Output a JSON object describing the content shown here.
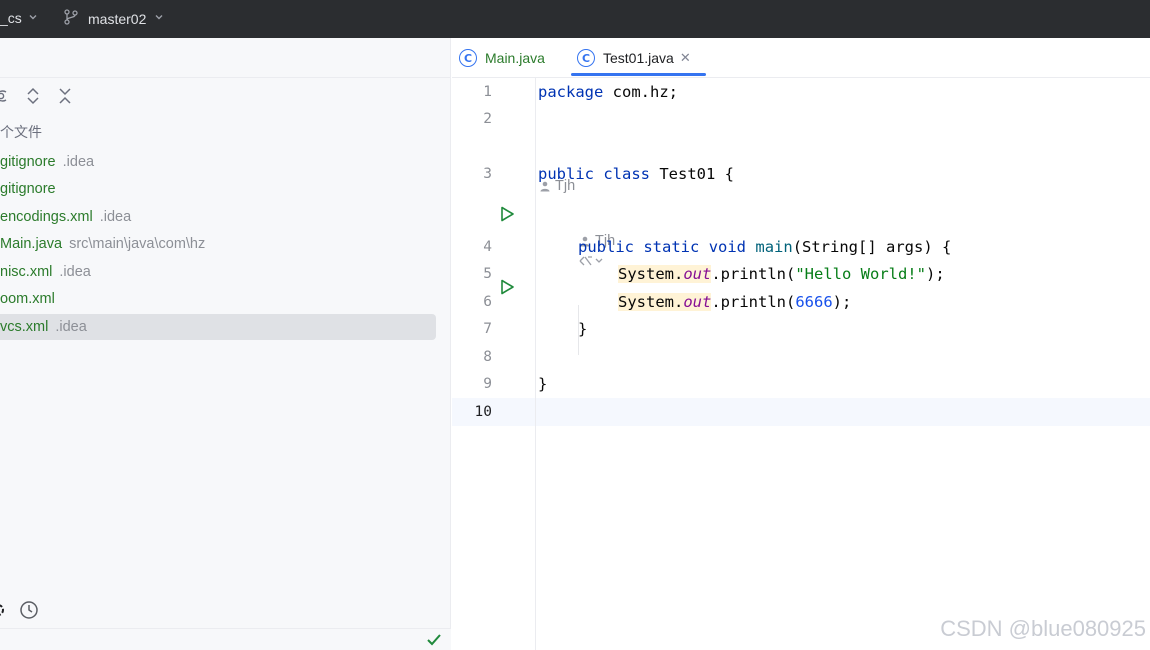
{
  "titlebar": {
    "project": "_cs",
    "branch": "master02"
  },
  "project_panel": {
    "caption": "个文件",
    "files": [
      {
        "name": "gitignore",
        "location": ".idea",
        "selected": false
      },
      {
        "name": "gitignore",
        "location": "",
        "selected": false
      },
      {
        "name": "encodings.xml",
        "location": ".idea",
        "selected": false
      },
      {
        "name": "Main.java",
        "location": "src\\main\\java\\com\\hz",
        "selected": false
      },
      {
        "name": "nisc.xml",
        "location": ".idea",
        "selected": false
      },
      {
        "name": "oom.xml",
        "location": "",
        "selected": false
      },
      {
        "name": "vcs.xml",
        "location": ".idea",
        "selected": true
      }
    ],
    "toolbar_icons": [
      "eye-icon",
      "expand-all-icon",
      "collapse-all-icon"
    ],
    "bottom_icons": [
      "settings-icon",
      "history-icon"
    ],
    "status_icon": "checkmark-icon"
  },
  "editor": {
    "tabs": [
      {
        "label": "Main.java",
        "icon_letter": "C",
        "active": false
      },
      {
        "label": "Test01.java",
        "icon_letter": "C",
        "active": true,
        "close": "✕"
      }
    ],
    "line_numbers": [
      "1",
      "2",
      "3",
      "4",
      "5",
      "6",
      "7",
      "8",
      "9",
      "10"
    ],
    "current_line": "10",
    "author_hint": "Tjh",
    "code": {
      "l1_kw": "package",
      "l1_rest": " com.hz;",
      "l3_kw1": "public",
      "l3_kw2": "class",
      "l3_rest": " Test01 {",
      "l4_kw1": "public",
      "l4_kw2": "static",
      "l4_kw3": "void",
      "l4_fn": "main",
      "l4_rest": "(String[] args) {",
      "l5_sys": "System.",
      "l5_out": "out",
      "l5_mid": ".println(",
      "l5_str": "\"Hello World!\"",
      "l5_end": ");",
      "l6_sys": "System.",
      "l6_out": "out",
      "l6_mid": ".println(",
      "l6_num": "6666",
      "l6_end": ");",
      "l7": "}",
      "l9": "}"
    }
  },
  "watermark": "CSDN @blue080925",
  "colors": {
    "keyword": "#0033b3",
    "string": "#067d17",
    "number": "#1750eb",
    "field": "#871094",
    "file_vcs": "#2b7b2b",
    "accent": "#3574f0",
    "run": "#208a3c"
  }
}
